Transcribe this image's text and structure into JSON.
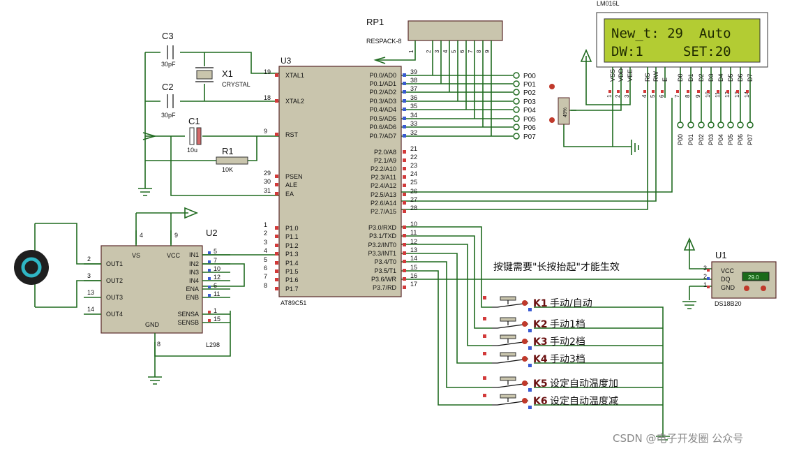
{
  "u3": {
    "ref": "U3",
    "part": "AT89C51",
    "left_pins": [
      {
        "num": "19",
        "name": "XTAL1"
      },
      {
        "num": "18",
        "name": "XTAL2"
      },
      {
        "num": "9",
        "name": "RST"
      },
      {
        "num": "29",
        "name": "PSEN"
      },
      {
        "num": "30",
        "name": "ALE"
      },
      {
        "num": "31",
        "name": "EA"
      },
      {
        "num": "1",
        "name": "P1.0"
      },
      {
        "num": "2",
        "name": "P1.1"
      },
      {
        "num": "3",
        "name": "P1.2"
      },
      {
        "num": "4",
        "name": "P1.3"
      },
      {
        "num": "5",
        "name": "P1.4"
      },
      {
        "num": "6",
        "name": "P1.5"
      },
      {
        "num": "7",
        "name": "P1.6"
      },
      {
        "num": "8",
        "name": "P1.7"
      }
    ],
    "right_pins": [
      {
        "num": "39",
        "name": "P0.0/AD0"
      },
      {
        "num": "38",
        "name": "P0.1/AD1"
      },
      {
        "num": "37",
        "name": "P0.2/AD2"
      },
      {
        "num": "36",
        "name": "P0.3/AD3"
      },
      {
        "num": "35",
        "name": "P0.4/AD4"
      },
      {
        "num": "34",
        "name": "P0.5/AD5"
      },
      {
        "num": "33",
        "name": "P0.6/AD6"
      },
      {
        "num": "32",
        "name": "P0.7/AD7"
      },
      {
        "num": "21",
        "name": "P2.0/A8"
      },
      {
        "num": "22",
        "name": "P2.1/A9"
      },
      {
        "num": "23",
        "name": "P2.2/A10"
      },
      {
        "num": "24",
        "name": "P2.3/A11"
      },
      {
        "num": "25",
        "name": "P2.4/A12"
      },
      {
        "num": "26",
        "name": "P2.5/A13"
      },
      {
        "num": "27",
        "name": "P2.6/A14"
      },
      {
        "num": "28",
        "name": "P2.7/A15"
      },
      {
        "num": "10",
        "name": "P3.0/RXD"
      },
      {
        "num": "11",
        "name": "P3.1/TXD"
      },
      {
        "num": "12",
        "name": "P3.2/INT0"
      },
      {
        "num": "13",
        "name": "P3.3/INT1"
      },
      {
        "num": "14",
        "name": "P3.4/T0"
      },
      {
        "num": "15",
        "name": "P3.5/T1"
      },
      {
        "num": "16",
        "name": "P3.6/WR"
      },
      {
        "num": "17",
        "name": "P3.7/RD"
      }
    ]
  },
  "rp1": {
    "ref": "RP1",
    "part": "RESPACK-8",
    "pins": [
      "1",
      "2",
      "3",
      "4",
      "5",
      "6",
      "7",
      "8",
      "9"
    ]
  },
  "p0_labels": [
    "P00",
    "P01",
    "P02",
    "P03",
    "P04",
    "P05",
    "P06",
    "P07"
  ],
  "lcd": {
    "part": "LM016L",
    "line1": "New_t: 29  Auto",
    "line2": "DW:1     SET:20",
    "pins": [
      {
        "num": "1",
        "name": "VSS"
      },
      {
        "num": "2",
        "name": "VDD"
      },
      {
        "num": "3",
        "name": "VEE"
      },
      {
        "num": "4",
        "name": "RS"
      },
      {
        "num": "5",
        "name": "RW"
      },
      {
        "num": "6",
        "name": "E"
      },
      {
        "num": "7",
        "name": "D0"
      },
      {
        "num": "8",
        "name": "D1"
      },
      {
        "num": "9",
        "name": "D2"
      },
      {
        "num": "10",
        "name": "D3"
      },
      {
        "num": "11",
        "name": "D4"
      },
      {
        "num": "12",
        "name": "D5"
      },
      {
        "num": "13",
        "name": "D6"
      },
      {
        "num": "14",
        "name": "D7"
      }
    ]
  },
  "pot": {
    "value": "49%"
  },
  "c3": {
    "ref": "C3",
    "value": "30pF"
  },
  "c2": {
    "ref": "C2",
    "value": "30pF"
  },
  "x1": {
    "ref": "X1",
    "part": "CRYSTAL"
  },
  "c1": {
    "ref": "C1",
    "value": "10u"
  },
  "r1": {
    "ref": "R1",
    "value": "10K"
  },
  "u2": {
    "ref": "U2",
    "part": "L298",
    "top": [
      {
        "num": "4",
        "name": "VS"
      },
      {
        "num": "9",
        "name": "VCC"
      }
    ],
    "left": [
      {
        "num": "2",
        "name": "OUT1"
      },
      {
        "num": "3",
        "name": "OUT2"
      },
      {
        "num": "13",
        "name": "OUT3"
      },
      {
        "num": "14",
        "name": "OUT4"
      }
    ],
    "right": [
      {
        "num": "5",
        "name": "IN1"
      },
      {
        "num": "7",
        "name": "IN2"
      },
      {
        "num": "10",
        "name": "IN3"
      },
      {
        "num": "12",
        "name": "IN4"
      },
      {
        "num": "6",
        "name": "ENA"
      },
      {
        "num": "11",
        "name": "ENB"
      },
      {
        "num": "1",
        "name": "SENSA"
      },
      {
        "num": "15",
        "name": "SENSB"
      }
    ],
    "bottom": {
      "num": "8",
      "name": "GND"
    }
  },
  "u1": {
    "ref": "U1",
    "part": "DS18B20",
    "reading": "29.0",
    "pins": [
      {
        "num": "3",
        "name": "VCC"
      },
      {
        "num": "2",
        "name": "DQ"
      },
      {
        "num": "1",
        "name": "GND"
      }
    ]
  },
  "note": "按键需要\"长按抬起\"才能生效",
  "keys": [
    {
      "ref": "K1",
      "label": "手动/自动"
    },
    {
      "ref": "K2",
      "label": "手动1档"
    },
    {
      "ref": "K3",
      "label": "手动2档"
    },
    {
      "ref": "K4",
      "label": "手动3档"
    },
    {
      "ref": "K5",
      "label": "设定自动温度加"
    },
    {
      "ref": "K6",
      "label": "设定自动温度减"
    }
  ],
  "watermark": "CSDN @电子开发圈 公众号",
  "colors": {
    "wire": "#1f6a1f",
    "chip": "#c9c5ad",
    "lcd": "#b3cc33",
    "pin_red": "#d23a3a",
    "pin_blue": "#3a5ad2"
  }
}
